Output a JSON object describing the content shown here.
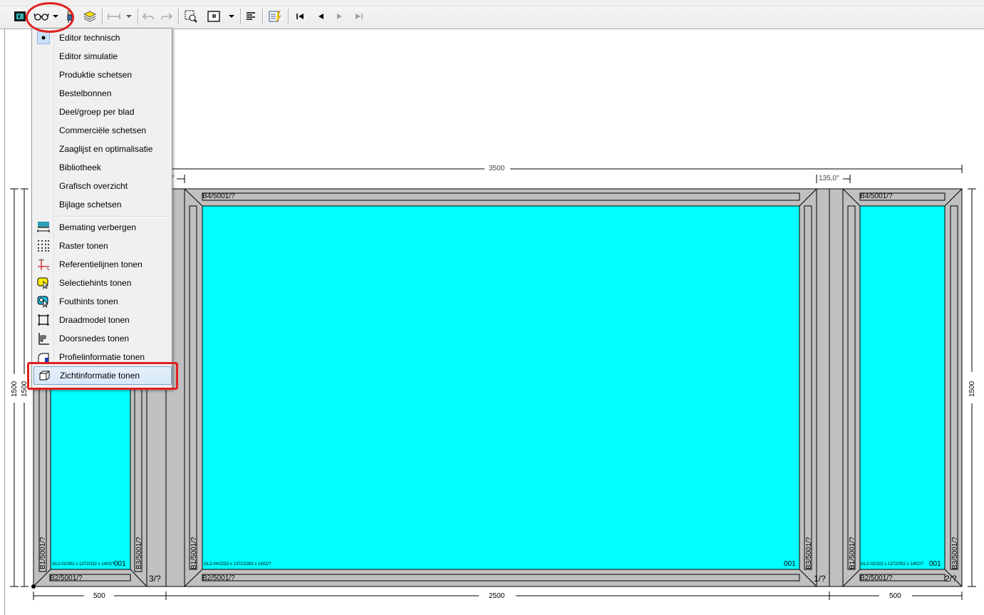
{
  "menu": {
    "items": [
      {
        "label": "Editor technisch",
        "checked": true
      },
      {
        "label": "Editor simulatie"
      },
      {
        "label": "Produktie schetsen"
      },
      {
        "label": "Bestelbonnen"
      },
      {
        "label": "Deel/groep per blad"
      },
      {
        "label": "Commerciële schetsen"
      },
      {
        "label": "Zaaglijst en optimalisatie"
      },
      {
        "label": "Bibliotheek"
      },
      {
        "label": "Grafisch overzicht"
      },
      {
        "label": "Bijlage schetsen"
      },
      {
        "label": "Bemating verbergen",
        "icon": "dimension-icon"
      },
      {
        "label": "Raster tonen",
        "icon": "grid-icon"
      },
      {
        "label": "Referentielijnen tonen",
        "icon": "reference-lines-icon"
      },
      {
        "label": "Selectiehints tonen",
        "icon": "selection-hint-icon"
      },
      {
        "label": "Fouthints tonen",
        "icon": "error-hint-icon"
      },
      {
        "label": "Draadmodel tonen",
        "icon": "wireframe-icon"
      },
      {
        "label": "Doorsnedes tonen",
        "icon": "cross-section-icon"
      },
      {
        "label": "Profielinformatie tonen",
        "icon": "profile-info-icon"
      },
      {
        "label": "Zichtinformatie tonen",
        "icon": "view-info-icon",
        "highlighted": true
      }
    ]
  },
  "drawing": {
    "dim_top_total": "3500",
    "dim_top_left_angle": "°",
    "dim_top_right_angle": "135,0°",
    "dim_bottom": [
      "500",
      "2500",
      "500"
    ],
    "dim_left_outer": "1500",
    "dim_left_inner": "1500",
    "dim_right": "1500",
    "left_panel": {
      "bottom_profile": "B2/5001/?",
      "left_profile": "B1/5001/?",
      "right_profile": "B3/5001/?",
      "glass_info": "GL2-02/302 x 1372/332 x 1402/?",
      "number": "001",
      "mullion_label": "3/?"
    },
    "center_panel": {
      "top_profile": "B4/5001/?",
      "bottom_profile": "B2/5001/?",
      "left_profile": "B1/5001/?",
      "right_profile": "B3/5001/?",
      "glass_info": "GL2-04/2252 x 1372/2282 x 1402/?",
      "number": "001",
      "mullion_label": "1/?"
    },
    "right_panel": {
      "top_profile": "B4/5001/?",
      "bottom_profile": "B2/5001/?",
      "left_profile": "B1/5001/?",
      "right_profile": "B3/5001/?",
      "glass_info": "GL2-02/322 x 1372/352 x 1402/?",
      "number": "001",
      "corner_label": "2/?"
    }
  },
  "colors": {
    "glass": "#00ffff",
    "frame": "#c0c0c0",
    "highlight": "#e02020"
  }
}
